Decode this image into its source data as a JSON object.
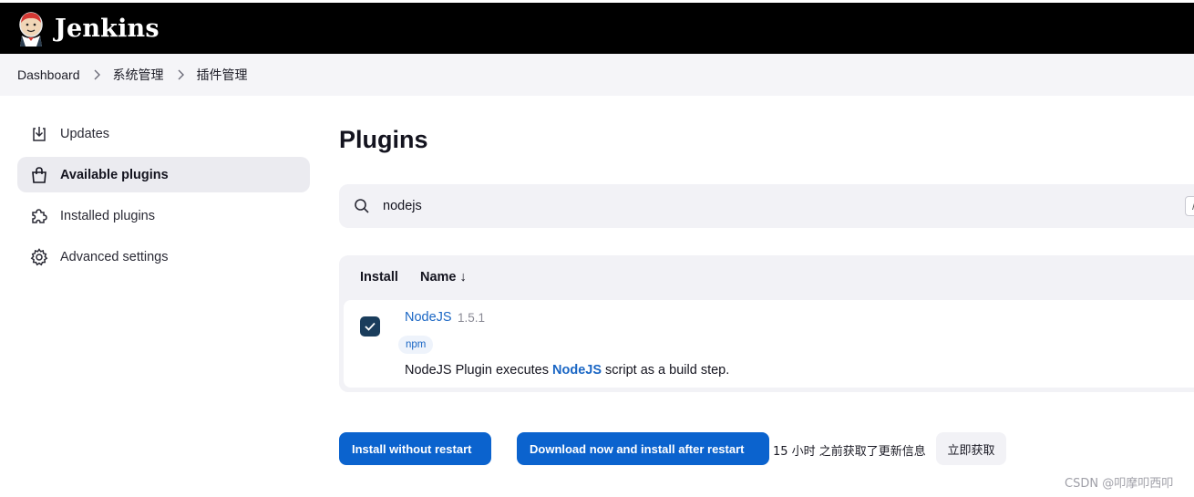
{
  "header": {
    "brand": "Jenkins"
  },
  "breadcrumbs": [
    "Dashboard",
    "系统管理",
    "插件管理"
  ],
  "sidebar": {
    "items": [
      {
        "label": "Updates",
        "icon": "download-icon",
        "active": false
      },
      {
        "label": "Available plugins",
        "icon": "shopping-bag-icon",
        "active": true
      },
      {
        "label": "Installed plugins",
        "icon": "puzzle-icon",
        "active": false
      },
      {
        "label": "Advanced settings",
        "icon": "gear-icon",
        "active": false
      }
    ]
  },
  "main": {
    "title": "Plugins",
    "search": {
      "value": "nodejs",
      "shortcut": "/"
    },
    "table": {
      "headers": {
        "install": "Install",
        "name": "Name ↓"
      },
      "rows": [
        {
          "checked": true,
          "name": "NodeJS",
          "version": "1.5.1",
          "tag": "npm",
          "desc_before": "NodeJS Plugin executes ",
          "desc_highlight": "NodeJS",
          "desc_after": " script as a build step."
        }
      ]
    },
    "buttons": {
      "install_without_restart": "Install without restart",
      "download_install_after_restart": "Download now and install after restart"
    },
    "update_info": "15 小时 之前获取了更新信息",
    "fetch_now": "立即获取"
  },
  "watermark": "CSDN @叩摩叩西叩",
  "colors": {
    "accent": "#0b63ce",
    "checkbox": "#1a3d5c",
    "link": "#1a66c4"
  }
}
